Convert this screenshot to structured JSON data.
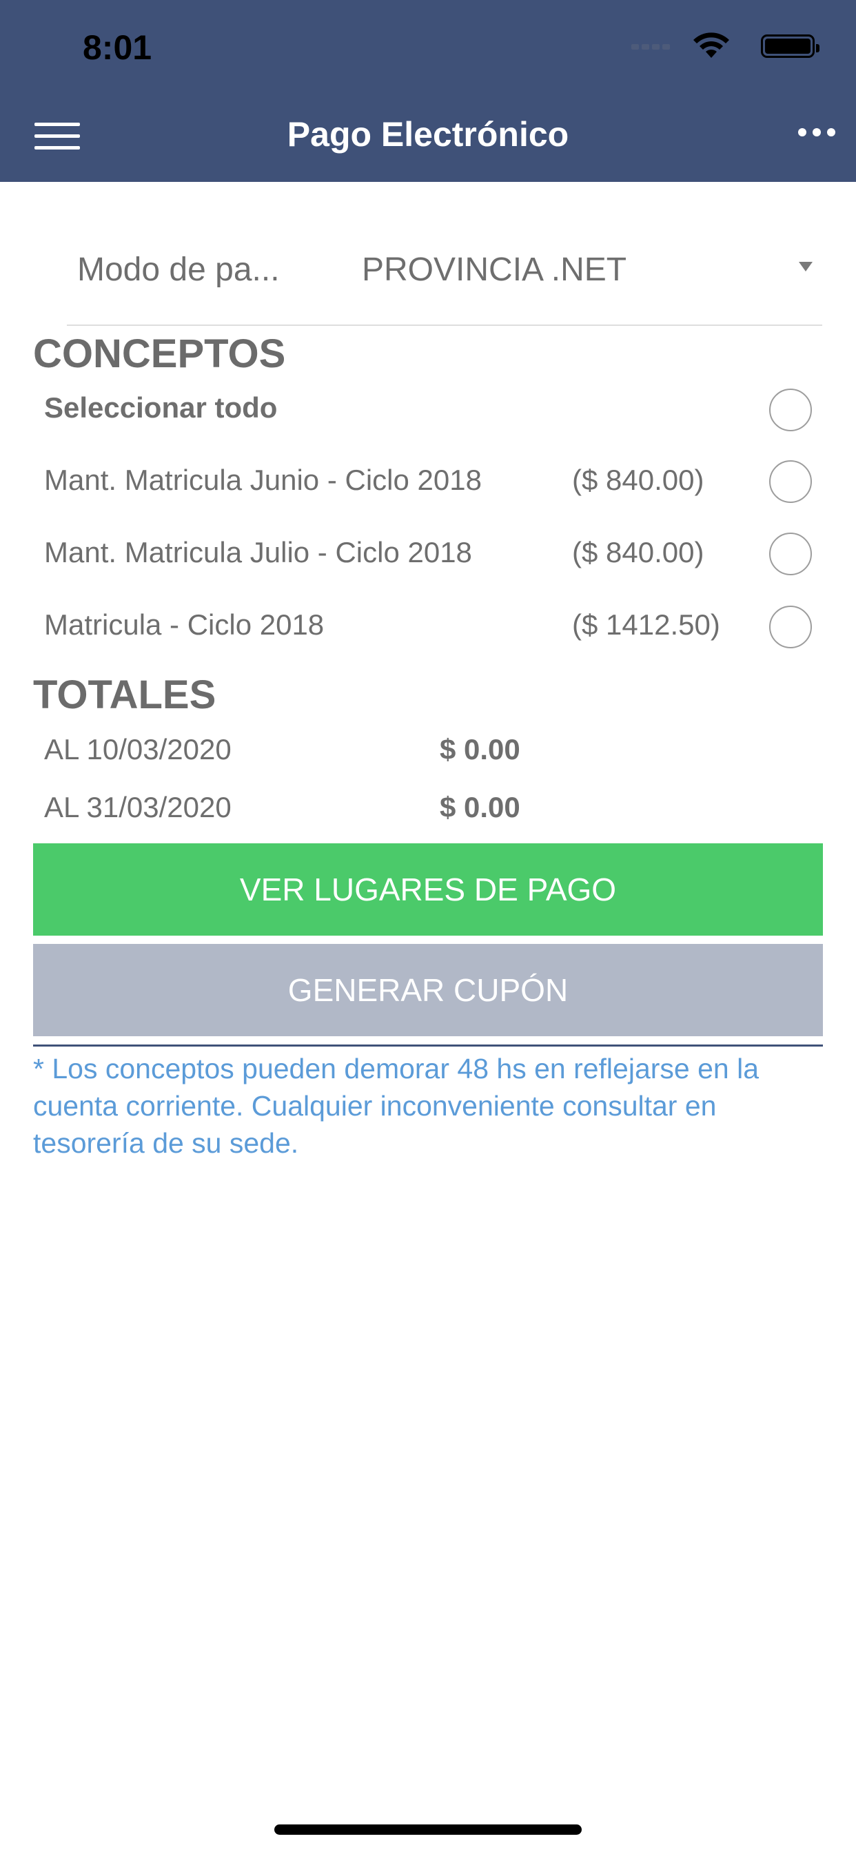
{
  "status_bar": {
    "time": "8:01",
    "icons": [
      "signal-icon",
      "wifi-icon",
      "battery-icon"
    ]
  },
  "nav": {
    "title": "Pago Electrónico",
    "menu_icon": "hamburger-menu-icon",
    "more_icon": "more-dots-icon"
  },
  "payment_mode": {
    "label": "Modo de pa...",
    "selected": "PROVINCIA .NET"
  },
  "conceptos": {
    "title": "CONCEPTOS",
    "select_all": "Seleccionar todo",
    "items": [
      {
        "label": "Mant. Matricula Junio - Ciclo 2018",
        "price": "($ 840.00)",
        "selected": false
      },
      {
        "label": "Mant. Matricula Julio - Ciclo 2018",
        "price": "($ 840.00)",
        "selected": false
      },
      {
        "label": "Matricula - Ciclo 2018",
        "price": "($ 1412.50)",
        "selected": false
      }
    ]
  },
  "totales": {
    "title": "TOTALES",
    "rows": [
      {
        "label": "AL 10/03/2020",
        "value": "$ 0.00"
      },
      {
        "label": "AL 31/03/2020",
        "value": "$ 0.00"
      }
    ]
  },
  "buttons": {
    "ver_lugares": "VER LUGARES DE PAGO",
    "generar_cupon": "GENERAR CUPÓN"
  },
  "note": "* Los conceptos pueden demorar 48 hs en reflejarse en la cuenta corriente. Cualquier inconveniente consultar en tesorería de su sede.",
  "colors": {
    "header": "#3f5178",
    "primary_button": "#4bca6a",
    "secondary_button": "#b1b8c7",
    "note_text": "#5b9bd8"
  }
}
